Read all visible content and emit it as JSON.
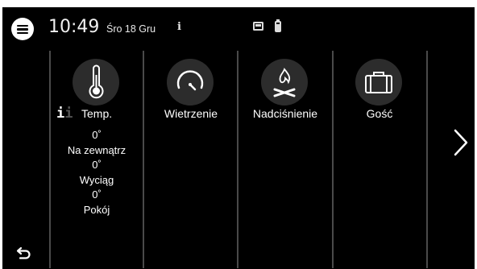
{
  "status_bar": {
    "time": "10:49",
    "date": "Śro 18 Gru",
    "info_label": "i",
    "icons": [
      "menu-icon",
      "display-icon",
      "battery-icon"
    ]
  },
  "tiles": [
    {
      "icon": "thermometer-icon",
      "label": "Temp.",
      "info_label": "i",
      "info_label_faint": "i",
      "readings": {
        "outside_value": "0˚",
        "outside_label": "Na zewnątrz",
        "exhaust_value": "0˚",
        "exhaust_label": "Wyciąg",
        "room_value": "0˚",
        "room_label": "Pokój"
      }
    },
    {
      "icon": "speedometer-icon",
      "label": "Wietrzenie"
    },
    {
      "icon": "fireplace-icon",
      "label": "Nadciśnienie"
    },
    {
      "icon": "suitcase-icon",
      "label": "Gość"
    }
  ],
  "navigation": {
    "next_icon": "chevron-right-icon",
    "back_icon": "back-arrow-icon"
  },
  "colors": {
    "background": "#000000",
    "icon_circle": "#2c2c2c",
    "separator": "#4a4a4a",
    "text": "#ffffff"
  }
}
